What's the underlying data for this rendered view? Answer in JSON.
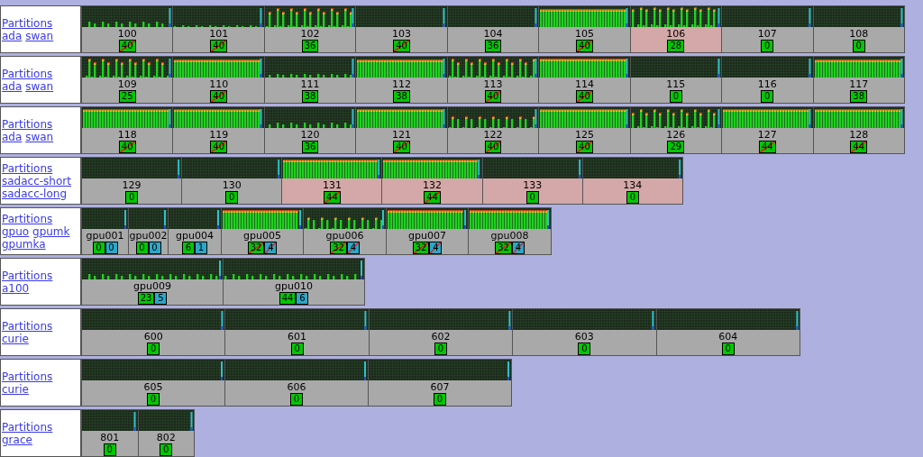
{
  "rows": [
    {
      "links": [
        "Partitions",
        "ada",
        "swan"
      ],
      "nodes": [
        {
          "name": "100",
          "highlighted": false,
          "counts": [
            {
              "kind": "cpu",
              "value": "40",
              "full": true
            }
          ]
        },
        {
          "name": "101",
          "highlighted": false,
          "counts": [
            {
              "kind": "cpu",
              "value": "40",
              "full": true
            }
          ]
        },
        {
          "name": "102",
          "highlighted": false,
          "counts": [
            {
              "kind": "cpu",
              "value": "36",
              "full": false
            }
          ]
        },
        {
          "name": "103",
          "highlighted": false,
          "counts": [
            {
              "kind": "cpu",
              "value": "40",
              "full": true
            }
          ]
        },
        {
          "name": "104",
          "highlighted": false,
          "counts": [
            {
              "kind": "cpu",
              "value": "36",
              "full": false
            }
          ]
        },
        {
          "name": "105",
          "highlighted": false,
          "counts": [
            {
              "kind": "cpu",
              "value": "40",
              "full": true
            }
          ]
        },
        {
          "name": "106",
          "highlighted": true,
          "counts": [
            {
              "kind": "cpu",
              "value": "28",
              "full": false
            }
          ]
        },
        {
          "name": "107",
          "highlighted": false,
          "counts": [
            {
              "kind": "cpu",
              "value": "0",
              "full": false
            }
          ]
        },
        {
          "name": "108",
          "highlighted": false,
          "counts": [
            {
              "kind": "cpu",
              "value": "0",
              "full": false
            }
          ]
        }
      ]
    },
    {
      "links": [
        "Partitions",
        "ada",
        "swan"
      ],
      "nodes": [
        {
          "name": "109",
          "highlighted": false,
          "counts": [
            {
              "kind": "cpu",
              "value": "25",
              "full": false
            }
          ]
        },
        {
          "name": "110",
          "highlighted": false,
          "counts": [
            {
              "kind": "cpu",
              "value": "40",
              "full": true
            }
          ]
        },
        {
          "name": "111",
          "highlighted": false,
          "counts": [
            {
              "kind": "cpu",
              "value": "38",
              "full": false
            }
          ]
        },
        {
          "name": "112",
          "highlighted": false,
          "counts": [
            {
              "kind": "cpu",
              "value": "38",
              "full": false
            }
          ]
        },
        {
          "name": "113",
          "highlighted": false,
          "counts": [
            {
              "kind": "cpu",
              "value": "40",
              "full": true
            }
          ]
        },
        {
          "name": "114",
          "highlighted": false,
          "counts": [
            {
              "kind": "cpu",
              "value": "40",
              "full": true
            }
          ]
        },
        {
          "name": "115",
          "highlighted": false,
          "counts": [
            {
              "kind": "cpu",
              "value": "0",
              "full": false
            }
          ]
        },
        {
          "name": "116",
          "highlighted": false,
          "counts": [
            {
              "kind": "cpu",
              "value": "0",
              "full": false
            }
          ]
        },
        {
          "name": "117",
          "highlighted": false,
          "counts": [
            {
              "kind": "cpu",
              "value": "38",
              "full": false
            }
          ]
        }
      ]
    },
    {
      "links": [
        "Partitions",
        "ada",
        "swan"
      ],
      "nodes": [
        {
          "name": "118",
          "highlighted": false,
          "counts": [
            {
              "kind": "cpu",
              "value": "40",
              "full": true
            }
          ]
        },
        {
          "name": "119",
          "highlighted": false,
          "counts": [
            {
              "kind": "cpu",
              "value": "40",
              "full": true
            }
          ]
        },
        {
          "name": "120",
          "highlighted": false,
          "counts": [
            {
              "kind": "cpu",
              "value": "36",
              "full": false
            }
          ]
        },
        {
          "name": "121",
          "highlighted": false,
          "counts": [
            {
              "kind": "cpu",
              "value": "40",
              "full": true
            }
          ]
        },
        {
          "name": "122",
          "highlighted": false,
          "counts": [
            {
              "kind": "cpu",
              "value": "40",
              "full": true
            }
          ]
        },
        {
          "name": "125",
          "highlighted": false,
          "counts": [
            {
              "kind": "cpu",
              "value": "40",
              "full": true
            }
          ]
        },
        {
          "name": "126",
          "highlighted": false,
          "counts": [
            {
              "kind": "cpu",
              "value": "29",
              "full": false
            }
          ]
        },
        {
          "name": "127",
          "highlighted": false,
          "counts": [
            {
              "kind": "cpu",
              "value": "44",
              "full": true
            }
          ]
        },
        {
          "name": "128",
          "highlighted": false,
          "counts": [
            {
              "kind": "cpu",
              "value": "44",
              "full": true
            }
          ]
        }
      ]
    },
    {
      "links": [
        "Partitions",
        "sadacc-short",
        "sadacc-long"
      ],
      "nodes": [
        {
          "name": "129",
          "highlighted": false,
          "counts": [
            {
              "kind": "cpu",
              "value": "0",
              "full": false
            }
          ]
        },
        {
          "name": "130",
          "highlighted": false,
          "counts": [
            {
              "kind": "cpu",
              "value": "0",
              "full": false
            }
          ]
        },
        {
          "name": "131",
          "highlighted": true,
          "counts": [
            {
              "kind": "cpu",
              "value": "44",
              "full": true
            }
          ]
        },
        {
          "name": "132",
          "highlighted": true,
          "counts": [
            {
              "kind": "cpu",
              "value": "44",
              "full": true
            }
          ]
        },
        {
          "name": "133",
          "highlighted": true,
          "counts": [
            {
              "kind": "cpu",
              "value": "0",
              "full": false
            }
          ]
        },
        {
          "name": "134",
          "highlighted": true,
          "counts": [
            {
              "kind": "cpu",
              "value": "0",
              "full": false
            }
          ]
        }
      ]
    },
    {
      "links": [
        "Partitions",
        "gpuo",
        "gpumk",
        "gpumka"
      ],
      "nodes": [
        {
          "name": "gpu001",
          "highlighted": false,
          "counts": [
            {
              "kind": "cpu",
              "value": "0",
              "full": false
            },
            {
              "kind": "gpu",
              "value": "0",
              "full": false
            }
          ]
        },
        {
          "name": "gpu002",
          "highlighted": false,
          "counts": [
            {
              "kind": "cpu",
              "value": "0",
              "full": false
            },
            {
              "kind": "gpu",
              "value": "0",
              "full": false
            }
          ]
        },
        {
          "name": "gpu004",
          "highlighted": false,
          "counts": [
            {
              "kind": "cpu",
              "value": "6",
              "full": false
            },
            {
              "kind": "gpu",
              "value": "1",
              "full": false
            }
          ]
        },
        {
          "name": "gpu005",
          "highlighted": false,
          "counts": [
            {
              "kind": "cpu",
              "value": "32",
              "full": true
            },
            {
              "kind": "gpu",
              "value": "4",
              "full": true
            }
          ]
        },
        {
          "name": "gpu006",
          "highlighted": false,
          "counts": [
            {
              "kind": "cpu",
              "value": "32",
              "full": true
            },
            {
              "kind": "gpu",
              "value": "4",
              "full": true
            }
          ]
        },
        {
          "name": "gpu007",
          "highlighted": false,
          "counts": [
            {
              "kind": "cpu",
              "value": "32",
              "full": true
            },
            {
              "kind": "gpu",
              "value": "4",
              "full": true
            }
          ]
        },
        {
          "name": "gpu008",
          "highlighted": false,
          "counts": [
            {
              "kind": "cpu",
              "value": "32",
              "full": true
            },
            {
              "kind": "gpu",
              "value": "4",
              "full": true
            }
          ]
        }
      ]
    },
    {
      "links": [
        "Partitions",
        "a100"
      ],
      "nodes": [
        {
          "name": "gpu009",
          "highlighted": false,
          "counts": [
            {
              "kind": "cpu",
              "value": "23",
              "full": false
            },
            {
              "kind": "gpu",
              "value": "5",
              "full": false
            }
          ]
        },
        {
          "name": "gpu010",
          "highlighted": false,
          "counts": [
            {
              "kind": "cpu",
              "value": "44",
              "full": false
            },
            {
              "kind": "gpu",
              "value": "6",
              "full": false
            }
          ]
        }
      ]
    },
    {
      "links": [
        "Partitions",
        "curie"
      ],
      "nodes": [
        {
          "name": "600",
          "highlighted": false,
          "counts": [
            {
              "kind": "cpu",
              "value": "0",
              "full": false
            }
          ]
        },
        {
          "name": "601",
          "highlighted": false,
          "counts": [
            {
              "kind": "cpu",
              "value": "0",
              "full": false
            }
          ]
        },
        {
          "name": "602",
          "highlighted": false,
          "counts": [
            {
              "kind": "cpu",
              "value": "0",
              "full": false
            }
          ]
        },
        {
          "name": "603",
          "highlighted": false,
          "counts": [
            {
              "kind": "cpu",
              "value": "0",
              "full": false
            }
          ]
        },
        {
          "name": "604",
          "highlighted": false,
          "counts": [
            {
              "kind": "cpu",
              "value": "0",
              "full": false
            }
          ]
        }
      ]
    },
    {
      "links": [
        "Partitions",
        "curie"
      ],
      "nodes": [
        {
          "name": "605",
          "highlighted": false,
          "counts": [
            {
              "kind": "cpu",
              "value": "0",
              "full": false
            }
          ]
        },
        {
          "name": "606",
          "highlighted": false,
          "counts": [
            {
              "kind": "cpu",
              "value": "0",
              "full": false
            }
          ]
        },
        {
          "name": "607",
          "highlighted": false,
          "counts": [
            {
              "kind": "cpu",
              "value": "0",
              "full": false
            }
          ]
        }
      ]
    },
    {
      "links": [
        "Partitions",
        "grace"
      ],
      "nodes": [
        {
          "name": "801",
          "highlighted": false,
          "counts": [
            {
              "kind": "cpu",
              "value": "0",
              "full": false
            }
          ]
        },
        {
          "name": "802",
          "highlighted": false,
          "counts": [
            {
              "kind": "cpu",
              "value": "0",
              "full": false
            }
          ]
        }
      ]
    }
  ]
}
